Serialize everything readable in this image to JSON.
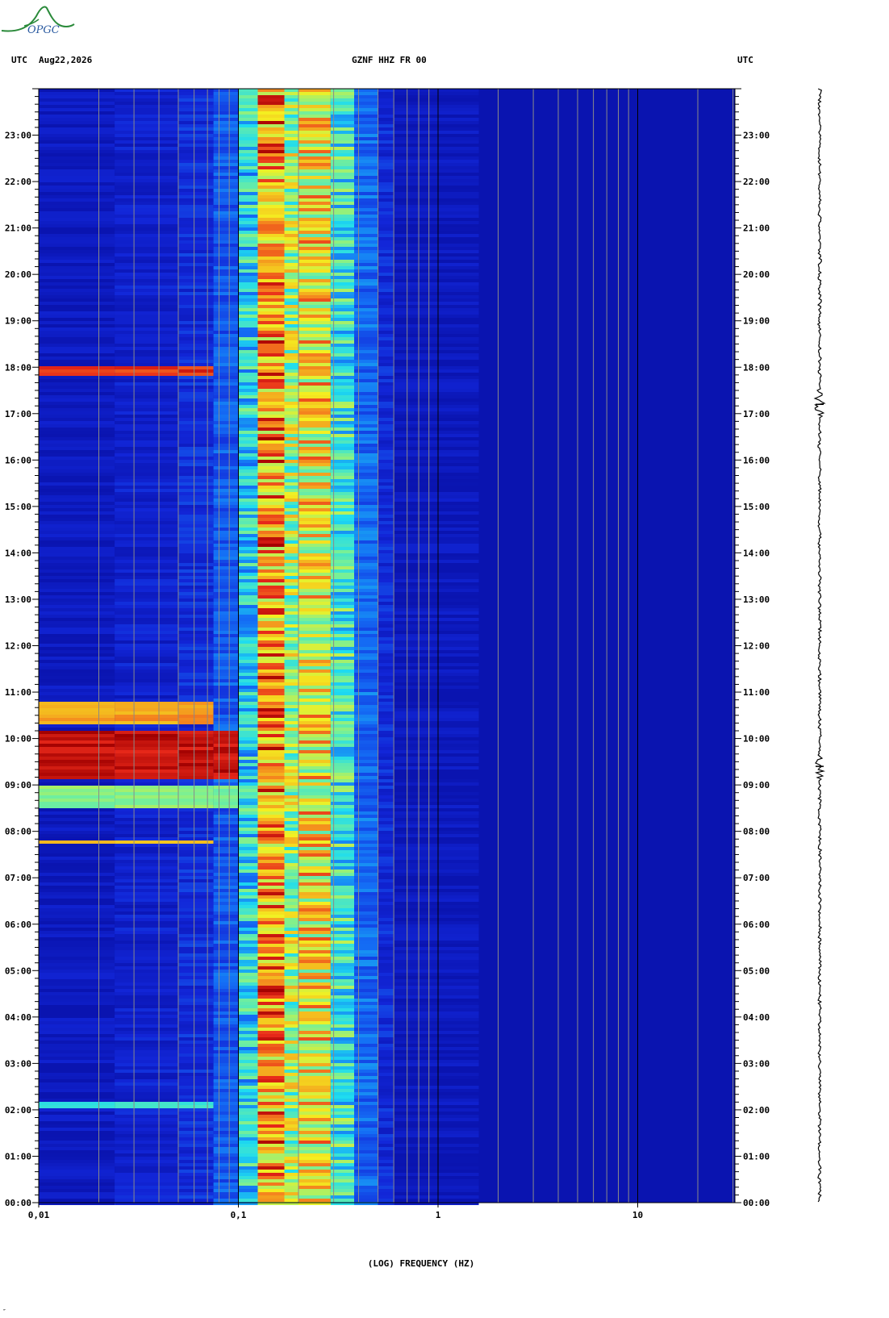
{
  "header": {
    "left_zone": "UTC",
    "date": "Aug22,2026",
    "station": "GZNF HHZ FR 00",
    "right_zone": "UTC"
  },
  "logo": {
    "text": "OPGC"
  },
  "footer": {
    "mark": "″"
  },
  "colors": {
    "background": "#0a14b0",
    "band_blue": "#1226d8",
    "cyan": "#20e0f0",
    "yellow": "#f4f020",
    "red": "#e8281a",
    "dark_red": "#a00000",
    "trace": "#000000"
  },
  "chart_data": {
    "type": "heatmap",
    "title": "GZNF HHZ FR 00",
    "xlabel": "(LOG) FREQUENCY (HZ)",
    "ylabel": "UTC",
    "x_scale": "log",
    "xlim": [
      0.01,
      30
    ],
    "x_ticks": [
      {
        "value": 0.01,
        "label": "0,01"
      },
      {
        "value": 0.1,
        "label": "0,1"
      },
      {
        "value": 1,
        "label": "1"
      },
      {
        "value": 10,
        "label": "10"
      }
    ],
    "ylim_hours": [
      0,
      24
    ],
    "y_ticks": [
      "00:00",
      "01:00",
      "02:00",
      "03:00",
      "04:00",
      "05:00",
      "06:00",
      "07:00",
      "08:00",
      "09:00",
      "10:00",
      "11:00",
      "12:00",
      "13:00",
      "14:00",
      "15:00",
      "16:00",
      "17:00",
      "18:00",
      "19:00",
      "20:00",
      "21:00",
      "22:00",
      "23:00"
    ],
    "grid": true,
    "frequency_bands": [
      {
        "f_min": 0.01,
        "f_max": 0.024,
        "level": 0.05
      },
      {
        "f_min": 0.024,
        "f_max": 0.05,
        "level": 0.1
      },
      {
        "f_min": 0.05,
        "f_max": 0.075,
        "level": 0.15
      },
      {
        "f_min": 0.075,
        "f_max": 0.1,
        "level": 0.25
      },
      {
        "f_min": 0.1,
        "f_max": 0.125,
        "level": 0.45
      },
      {
        "f_min": 0.125,
        "f_max": 0.17,
        "level": 0.82
      },
      {
        "f_min": 0.17,
        "f_max": 0.2,
        "level": 0.62
      },
      {
        "f_min": 0.2,
        "f_max": 0.29,
        "level": 0.72
      },
      {
        "f_min": 0.29,
        "f_max": 0.38,
        "level": 0.5
      },
      {
        "f_min": 0.38,
        "f_max": 0.5,
        "level": 0.28
      },
      {
        "f_min": 0.5,
        "f_max": 0.6,
        "level": 0.14
      },
      {
        "f_min": 0.6,
        "f_max": 1.6,
        "level": 0.04
      },
      {
        "f_min": 1.6,
        "f_max": 30,
        "level": 0.0
      }
    ],
    "events": [
      {
        "start_hour": 9.1,
        "end_hour": 10.2,
        "f_max": 0.1,
        "level": 1.0
      },
      {
        "start_hour": 10.3,
        "end_hour": 10.8,
        "f_max": 0.075,
        "level": 0.85
      },
      {
        "start_hour": 8.5,
        "end_hour": 9.0,
        "f_max": 0.1,
        "level": 0.65
      },
      {
        "start_hour": 17.8,
        "end_hour": 18.05,
        "f_max": 0.075,
        "level": 0.95
      },
      {
        "start_hour": 7.7,
        "end_hour": 7.82,
        "f_max": 0.075,
        "level": 0.8
      },
      {
        "start_hour": 2.05,
        "end_hour": 2.2,
        "f_max": 0.075,
        "level": 0.55
      }
    ],
    "waveform_events_hours": [
      9.4,
      17.2
    ]
  }
}
